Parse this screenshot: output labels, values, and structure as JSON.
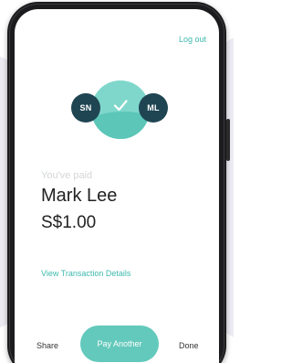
{
  "header": {
    "logout_label": "Log out"
  },
  "participants": {
    "sender_initials": "SN",
    "recipient_initials": "ML"
  },
  "result": {
    "status_label": "You've paid",
    "payee_name": "Mark Lee",
    "amount": "S$1.00",
    "details_link": "View Transaction Details"
  },
  "actions": {
    "share_label": "Share",
    "pay_another_label": "Pay Another",
    "done_label": "Done"
  },
  "colors": {
    "accent": "#3fb9ad",
    "button": "#63c9bc",
    "avatar_bg": "#1f4553",
    "check_bg": "#7fd7cb"
  },
  "icons": {
    "status": "check-icon"
  }
}
